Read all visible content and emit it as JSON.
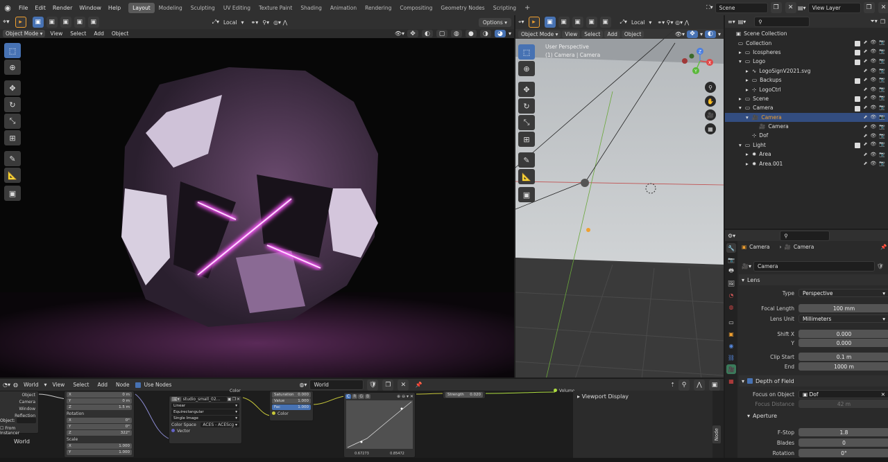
{
  "topbar": {
    "menus": [
      "File",
      "Edit",
      "Render",
      "Window",
      "Help"
    ],
    "workspaces": [
      "Layout",
      "Modeling",
      "Sculpting",
      "UV Editing",
      "Texture Paint",
      "Shading",
      "Animation",
      "Rendering",
      "Compositing",
      "Geometry Nodes",
      "Scripting"
    ],
    "active_workspace": "Layout",
    "scene": "Scene",
    "view_layer": "View Layer"
  },
  "viewport_left": {
    "mode": "Object Mode",
    "menus": [
      "View",
      "Select",
      "Add",
      "Object"
    ],
    "transform_orientation": "Local",
    "options": "Options"
  },
  "viewport_right": {
    "mode": "Object Mode",
    "menus": [
      "View",
      "Select",
      "Add",
      "Object"
    ],
    "transform_orientation": "Local",
    "overlay_title": "User Perspective",
    "overlay_subtitle": "(1) Camera | Camera",
    "gizmo_axes": [
      "Z",
      "Y",
      "X"
    ]
  },
  "outliner": {
    "title": "Scene Collection",
    "rows": [
      {
        "label": "Collection",
        "indent": 0,
        "expand": "",
        "icon": "collection",
        "color": "#ddd",
        "sel": false
      },
      {
        "label": "Icospheres",
        "indent": 1,
        "expand": "▸",
        "icon": "collection",
        "color": "#ddd",
        "sel": false
      },
      {
        "label": "Logo",
        "indent": 1,
        "expand": "▾",
        "icon": "collection",
        "color": "#ddd",
        "sel": false
      },
      {
        "label": "LogoSignV2021.svg",
        "indent": 2,
        "expand": "▸",
        "icon": "curve",
        "color": "#ddd",
        "sel": false
      },
      {
        "label": "Backups",
        "indent": 2,
        "expand": "▸",
        "icon": "collection",
        "color": "#ddd",
        "sel": false
      },
      {
        "label": "LogoCtrl",
        "indent": 2,
        "expand": "▸",
        "icon": "empty",
        "color": "#ddd",
        "sel": false
      },
      {
        "label": "Scene",
        "indent": 1,
        "expand": "▸",
        "icon": "collection",
        "color": "#ddd",
        "sel": false
      },
      {
        "label": "Camera",
        "indent": 1,
        "expand": "▾",
        "icon": "collection",
        "color": "#ddd",
        "sel": false
      },
      {
        "label": "Camera",
        "indent": 2,
        "expand": "▾",
        "icon": "camera",
        "color": "#f0a030",
        "sel": true
      },
      {
        "label": "Camera",
        "indent": 3,
        "expand": "",
        "icon": "camera-data",
        "color": "#ddd",
        "sel": false
      },
      {
        "label": "Dof",
        "indent": 2,
        "expand": "",
        "icon": "empty",
        "color": "#ddd",
        "sel": false
      },
      {
        "label": "Light",
        "indent": 1,
        "expand": "▾",
        "icon": "collection",
        "color": "#ddd",
        "sel": false
      },
      {
        "label": "Area",
        "indent": 2,
        "expand": "▸",
        "icon": "light",
        "color": "#ddd",
        "sel": false
      },
      {
        "label": "Area.001",
        "indent": 2,
        "expand": "▸",
        "icon": "light",
        "color": "#ddd",
        "sel": false
      }
    ]
  },
  "properties": {
    "breadcrumb_object": "Camera",
    "breadcrumb_data": "Camera",
    "datablock": "Camera",
    "lens_section": "Lens",
    "type_label": "Type",
    "type_value": "Perspective",
    "focal_label": "Focal Length",
    "focal_value": "100 mm",
    "lens_unit_label": "Lens Unit",
    "lens_unit_value": "Millimeters",
    "shift_x_label": "Shift X",
    "shift_x_value": "0.000",
    "shift_y_label": "Y",
    "shift_y_value": "0.000",
    "clip_start_label": "Clip Start",
    "clip_start_value": "0.1 m",
    "clip_end_label": "End",
    "clip_end_value": "1000 m",
    "dof_section": "Depth of Field",
    "focus_obj_label": "Focus on Object",
    "focus_obj_value": "Dof",
    "focus_dist_label": "Focus Distance",
    "focus_dist_value": "42 m",
    "aperture_section": "Aperture",
    "fstop_label": "F-Stop",
    "fstop_value": "1.8",
    "blades_label": "Blades",
    "blades_value": "0",
    "rotation_label": "Rotation",
    "rotation_value": "0°"
  },
  "node_editor": {
    "type": "World",
    "menus": [
      "View",
      "Select",
      "Add",
      "Node"
    ],
    "use_nodes": "Use Nodes",
    "world_name": "World",
    "world_label": "World",
    "sidebar_panel": "Viewport Display",
    "sidebar_tab": "Node",
    "lightpath_outputs": [
      "Object",
      "Camera",
      "Window",
      "Reflection"
    ],
    "object_label": "Object",
    "from_instancer": "From Instancer",
    "mapping": {
      "loc_x": "0 m",
      "loc_y": "0 m",
      "loc_z": "1.5 m",
      "rotation_label": "Rotation",
      "rot_x": "0°",
      "rot_y": "0°",
      "rot_z": "322°",
      "scale_label": "Scale",
      "scale_x": "1.000",
      "scale_y": "1.000"
    },
    "image": {
      "name": "studio_small_02...",
      "interp": "Linear",
      "proj": "Equirectangular",
      "ext": "Single Image",
      "cs_label": "Color Space",
      "cs_value": "ACES - ACEScg",
      "vector": "Vector",
      "color": "Color"
    },
    "hsv": {
      "sat_label": "Saturation",
      "sat_value": "0.000",
      "val_label": "Value",
      "val_value": "1.000",
      "fac_label": "Fac",
      "fac_value": "1.000",
      "color": "Color"
    },
    "curve": {
      "channels": [
        "C",
        "R",
        "G",
        "B"
      ],
      "val1": "0.67273",
      "val2": "0.85472"
    },
    "background": {
      "strength_label": "Strength",
      "strength_value": "0.020"
    },
    "output": {
      "volume": "Volume"
    }
  }
}
